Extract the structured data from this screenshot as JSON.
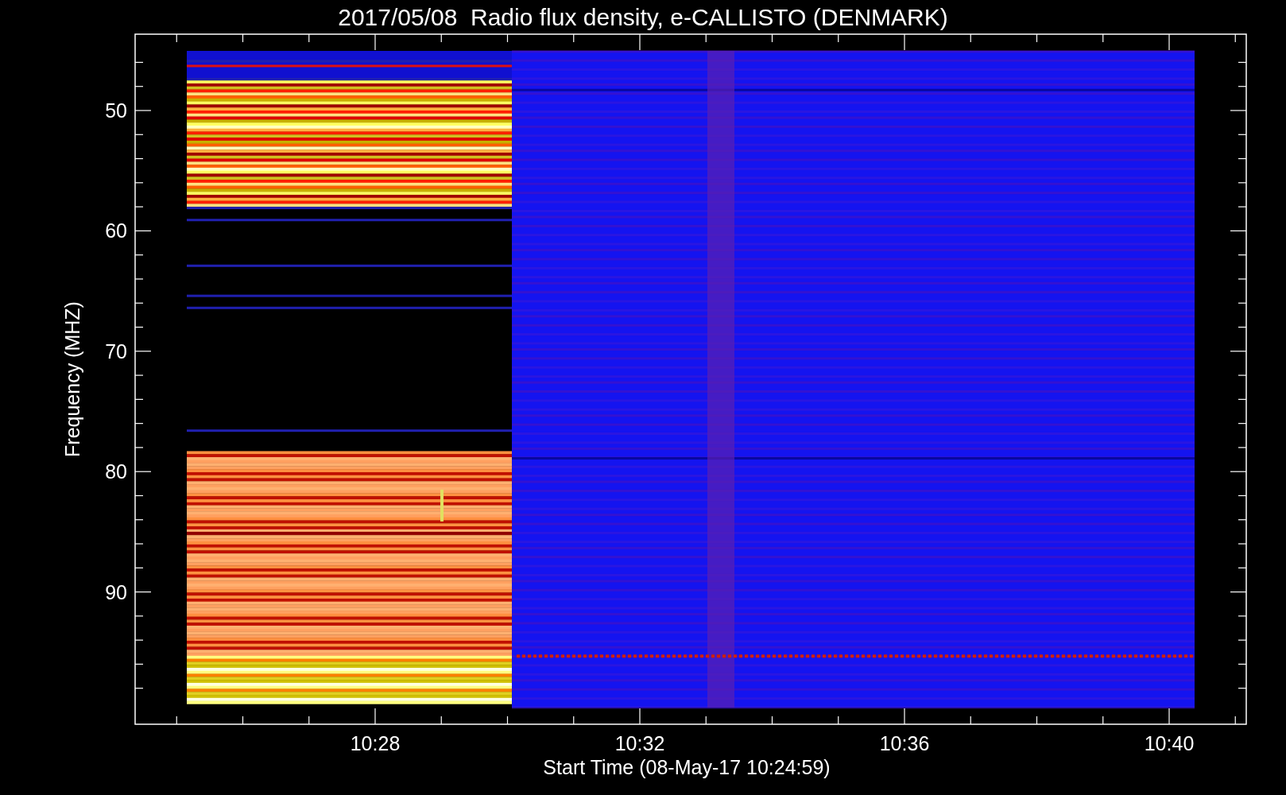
{
  "title": "2017/05/08  Radio flux density, e-CALLISTO (DENMARK)",
  "ylabel": "Frequency (MHZ)",
  "xlabel": "Start Time (08-May-17 10:24:59)",
  "yticks": [
    "50",
    "60",
    "70",
    "80",
    "90"
  ],
  "xticks": [
    "10:28",
    "10:32",
    "10:36",
    "10:40"
  ]
}
